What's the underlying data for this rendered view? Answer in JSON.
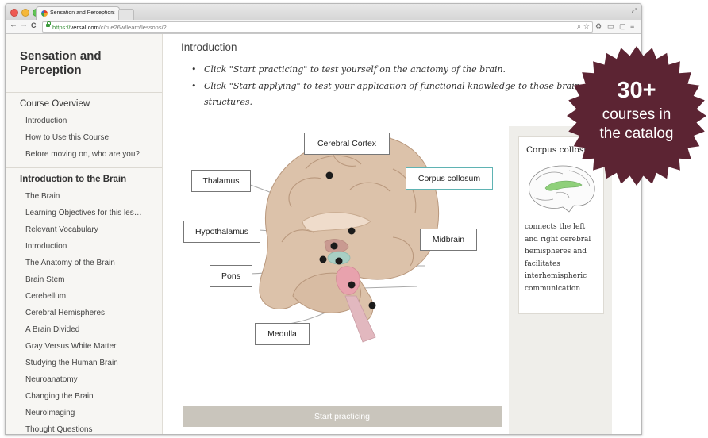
{
  "browser": {
    "tab_title": "Sensation and Perception",
    "tab_close": "×",
    "url_scheme": "https://",
    "url_host": "versal.com",
    "url_path": "/c/rue26w/learn/lessons/2",
    "back": "←",
    "forward": "→",
    "reload": "C",
    "icons": [
      "traffic-light-close",
      "traffic-light-minimize",
      "traffic-light-zoom",
      "back-arrow-icon",
      "forward-arrow-icon",
      "reload-icon",
      "lock-icon",
      "zoom-icon",
      "star-icon",
      "recycle-icon",
      "cast-icon",
      "menu-icon"
    ],
    "colors": {
      "close": "#ee5a52",
      "minimize": "#f5b83a",
      "zoom": "#61c554"
    }
  },
  "sidebar": {
    "course_title": "Sensation and Perception",
    "sections": [
      {
        "heading": "Course Overview",
        "items": [
          "Introduction",
          "How to Use this Course",
          "Before moving on, who are you?"
        ]
      },
      {
        "heading": "Introduction to the Brain",
        "items": [
          "The Brain",
          "Learning Objectives for this les…",
          "Relevant Vocabulary",
          "Introduction",
          "The Anatomy of the Brain",
          "Brain Stem",
          "Cerebellum",
          "Cerebral Hemispheres",
          "A Brain Divided",
          "Gray Versus White Matter",
          "Studying the Human Brain",
          "Neuroanatomy",
          "Changing the Brain",
          "Neuroimaging",
          "Thought Questions"
        ]
      }
    ]
  },
  "main": {
    "heading": "Introduction",
    "bullets": [
      "Click \"Start practicing\" to test yourself on the anatomy of the brain.",
      "Click \"Start applying\" to test your application of functional knowledge to those brain structures."
    ],
    "labels": {
      "cerebral_cortex": "Cerebral Cortex",
      "thalamus": "Thalamus",
      "corpus_collosum": "Corpus collosum",
      "hypothalamus": "Hypothalamus",
      "midbrain": "Midbrain",
      "pons": "Pons",
      "medulla": "Medulla"
    },
    "start_button": "Start practicing",
    "side_card": {
      "title": "Corpus collosum",
      "description": "connects the left and right cerebral hemispheres and facilitates interhemispheric communication"
    },
    "colors": {
      "brain": "#d9bfa6",
      "brainstem": "#e8a2ad",
      "highlight": "#5fb3b3",
      "button": "#c9c5bc"
    }
  },
  "promo_badge": {
    "number": "30+",
    "line1": "courses in",
    "line2": "the catalog",
    "color": "#5c2433"
  }
}
